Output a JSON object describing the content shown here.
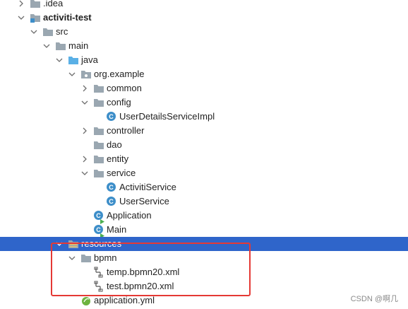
{
  "tree": {
    "idea": ".idea",
    "project": "activiti-test",
    "src": "src",
    "main": "main",
    "java": "java",
    "package": "org.example",
    "common": "common",
    "config": "config",
    "user_details_service_impl": "UserDetailsServiceImpl",
    "controller": "controller",
    "dao": "dao",
    "entity": "entity",
    "service": "service",
    "activiti_service": "ActivitiService",
    "user_service": "UserService",
    "application": "Application",
    "main_class": "Main",
    "resources": "resources",
    "bpmn": "bpmn",
    "temp_bpmn": "temp.bpmn20.xml",
    "test_bpmn": "test.bpmn20.xml",
    "application_yml": "application.yml"
  },
  "class_badge": "C",
  "watermark": "CSDN @啊几",
  "colors": {
    "selection": "#2f65ca",
    "folder": "#9aa7b1",
    "source_folder": "#5ab0e6",
    "class_icon": "#3d8ec9",
    "highlight_box": "#e53935"
  }
}
